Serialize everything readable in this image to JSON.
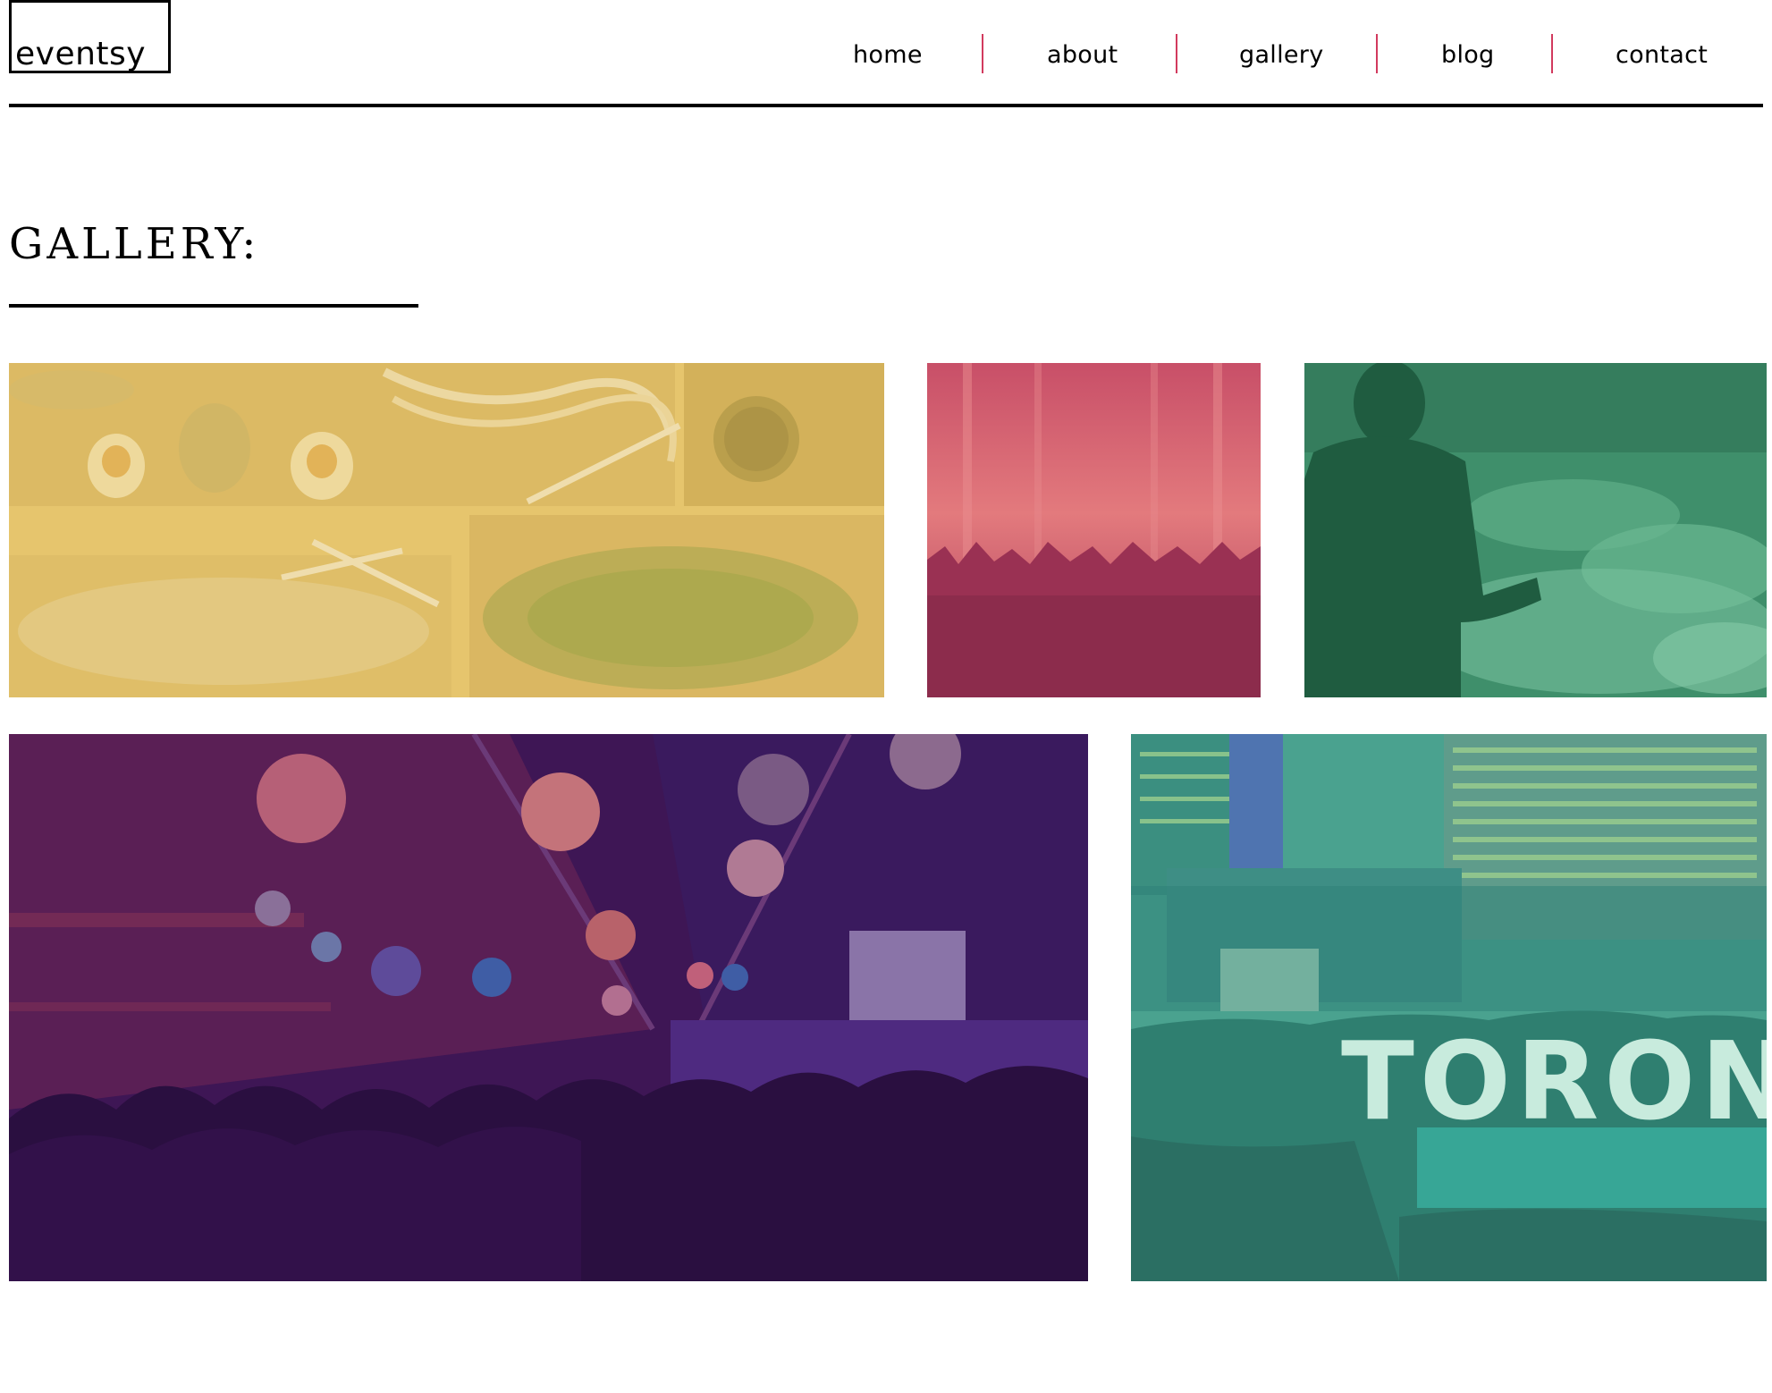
{
  "site": {
    "logo_text": "eventsy"
  },
  "nav": {
    "items": [
      {
        "label": "home"
      },
      {
        "label": "about"
      },
      {
        "label": "gallery"
      },
      {
        "label": "blog"
      },
      {
        "label": "contact"
      }
    ],
    "separator_color": "#d23a5e"
  },
  "page": {
    "title": "GALLERY:"
  },
  "gallery": {
    "images": [
      {
        "subject": "food platters on wooden boards",
        "tint": "#e6c56e"
      },
      {
        "subject": "concert crowd with stage lights",
        "tint": "#d55a73"
      },
      {
        "subject": "speaker presenting to audience",
        "tint": "#3a9269"
      },
      {
        "subject": "crowded indoor market with paper lanterns",
        "tint": "#3e1655"
      },
      {
        "subject": "Toronto sign at Nathan Phillips Square at night",
        "tint": "#4aa28f",
        "sign_text": "TORONT"
      }
    ]
  }
}
